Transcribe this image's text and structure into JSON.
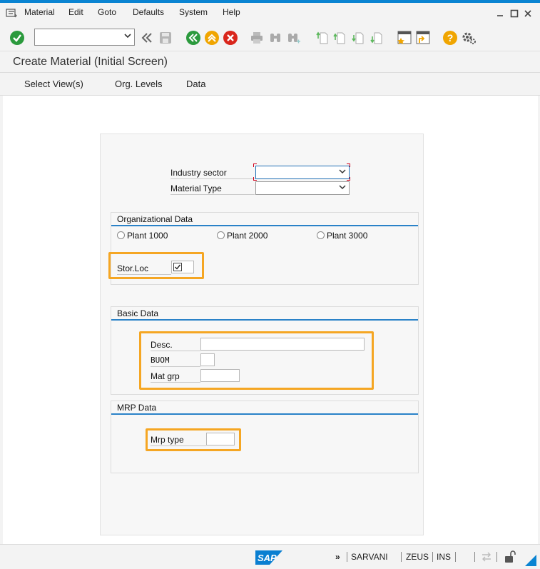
{
  "menu": {
    "items": [
      "Material",
      "Edit",
      "Goto",
      "Defaults",
      "System",
      "Help"
    ]
  },
  "toolbar": {
    "command_field_value": "",
    "icons": [
      "enter-icon",
      "back-double-icon",
      "save-icon",
      "back-icon",
      "exit-icon",
      "cancel-icon",
      "print-icon",
      "find-icon",
      "find-next-icon",
      "first-page-icon",
      "prev-page-icon",
      "next-page-icon",
      "last-page-icon",
      "create-session-icon",
      "shortcut-icon",
      "help-icon",
      "settings-icon"
    ]
  },
  "title": "Create Material (Initial Screen)",
  "appbar": {
    "buttons": [
      "Select View(s)",
      "Org. Levels",
      "Data"
    ]
  },
  "form": {
    "industry_sector_label": "Industry sector",
    "industry_sector_value": "",
    "material_type_label": "Material Type",
    "material_type_value": "",
    "org_data": {
      "title": "Organizational Data",
      "plants": [
        "Plant 1000",
        "Plant 2000",
        "Plant 3000"
      ],
      "stor_loc_label": "Stor.Loc",
      "stor_loc_checked": true
    },
    "basic_data": {
      "title": "Basic Data",
      "desc_label": "Desc.",
      "desc_value": "",
      "buom_label": "BUOM",
      "buom_value": "",
      "mat_grp_label": "Mat grp",
      "mat_grp_value": ""
    },
    "mrp_data": {
      "title": "MRP Data",
      "mrp_type_label": "Mrp type",
      "mrp_type_value": ""
    }
  },
  "status": {
    "arrow": "»",
    "user": "SARVANI",
    "system": "ZEUS",
    "mode": "INS",
    "logo": "SAP"
  },
  "colors": {
    "accent": "#0a84d2",
    "highlight": "#f5a623",
    "group_line": "#2a82c8"
  }
}
